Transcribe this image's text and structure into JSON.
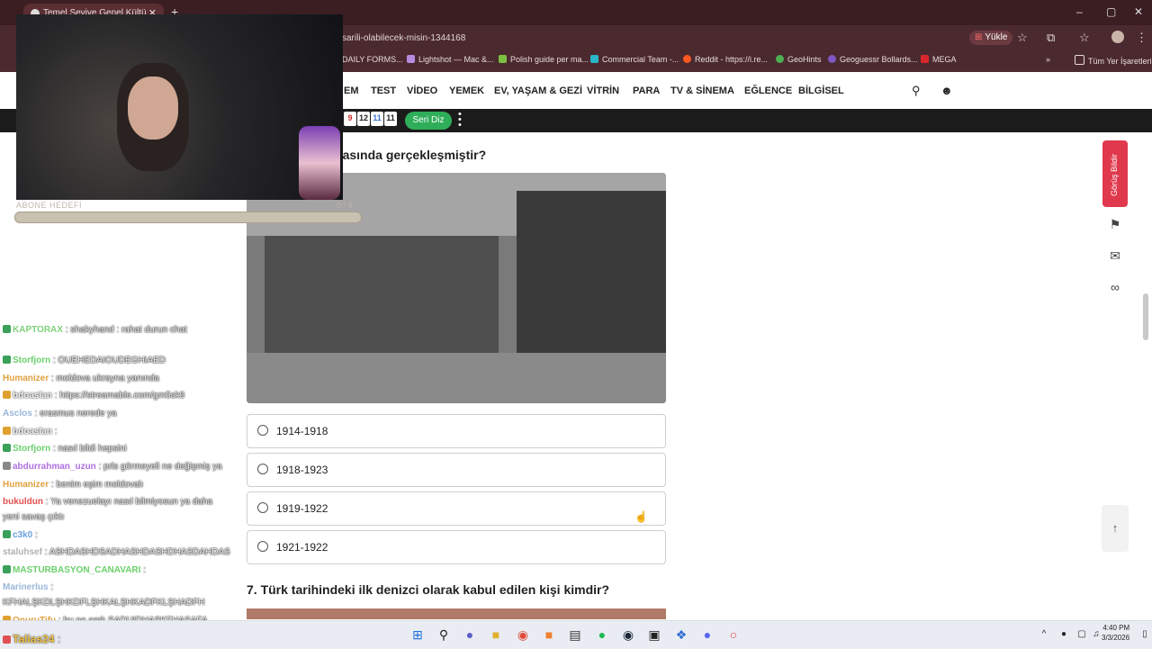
{
  "browser": {
    "tab_title": "Temel Seviye Genel Kültür Testi",
    "url_visible": "sarili-olabilecek-misin-1344168",
    "install_label": "Yükle",
    "bookmarks": [
      "DAILY FORMS...",
      "Lightshot — Mac &...",
      "Polish guide per ma...",
      "Commercial Team -...",
      "Reddit - https://i.re...",
      "GeoHints",
      "Geoguessr Bollards...",
      "MEGA"
    ],
    "all_bookmarks": "Tüm Yer İşaretleri"
  },
  "nav": {
    "items": [
      "EM",
      "TEST",
      "VİDEO",
      "YEMEK",
      "EV, YAŞAM & GEZİ",
      "VİTRİN",
      "PARA",
      "TV & SİNEMA",
      "EĞLENCE",
      "BİLGİSEL"
    ]
  },
  "subbar": {
    "scores": [
      "9",
      "12",
      "11",
      "11"
    ],
    "seri_diz": "Seri Diz"
  },
  "quiz": {
    "question_partial": "şı hangi yıllar arasında gerçekleşmiştir?",
    "options": [
      "1914-1918",
      "1918-1923",
      "1919-1922",
      "1921-1922"
    ],
    "next_question": "7. Türk tarihindeki ilk denizci olarak kabul edilen kişi kimdir?"
  },
  "right_panel": {
    "feedback_label": "Görüş Bildir"
  },
  "overlay": {
    "subgoal_label": "ABONE HEDEFİ",
    "subgoal_count": "0 / 4"
  },
  "chat": [
    {
      "user": "KAPTORAX",
      "msg": ": shakyhand : rahat durun chat",
      "color": "#7fd07a"
    },
    {
      "user": "Storfjorn",
      "msg": ": OUEHEDAIOUDEGHIAED",
      "color": "#6ad06a"
    },
    {
      "user": "Humanizer",
      "msg": ": moldova ukrayna yanında",
      "color": "#e0a040"
    },
    {
      "user": "bdoaslan",
      "msg": ": https://streamable.com/gm5sk9",
      "color": "#f0f0f0"
    },
    {
      "user": "Asclos",
      "msg": ": erasmus nerede ya",
      "color": "#9ab6d8"
    },
    {
      "user": "bdoaslan",
      "msg": ":",
      "color": "#f0f0f0"
    },
    {
      "user": "Storfjorn",
      "msg": ": nasıl bildi hepsini",
      "color": "#6ad06a"
    },
    {
      "user": "abdurrahman_uzun",
      "msg": ": prls görmeyeli ne değişmiş ya",
      "color": "#b070e0"
    },
    {
      "user": "Humanizer",
      "msg": ": benim eşim moldovalı",
      "color": "#e0a040"
    },
    {
      "user": "bukuldun",
      "msg": ": Ya venezuelayı nasıl bilmiyosun ya daha",
      "color": "#e05050"
    },
    {
      "user": "",
      "msg": "yeni savaş çıktı",
      "color": "#ffffff"
    },
    {
      "user": "c3k0",
      "msg": ":",
      "color": "#6aa0e0"
    },
    {
      "user": "staluhsef",
      "msg": ": ASHDASHDSADHASHDASHDHASDAHDAS",
      "color": "#b0b0b0"
    },
    {
      "user": "MASTURBASYON_CANAVARI",
      "msg": ":",
      "color": "#6ad06a"
    },
    {
      "user": "Marinerlus",
      "msg": ":",
      "color": "#9ab6d8"
    },
    {
      "user": "",
      "msg": "KFHALŞKDLŞHKDFLŞHKALŞHKADFKLŞHADFH",
      "color": "#ffffff"
    },
    {
      "user": "OnuruTifu",
      "msg": ": bu ne amk SADUIDHASKFHASAFA",
      "color": "#e0a040"
    },
    {
      "user": "Talias24",
      "msg": ":",
      "color": "#f0c040"
    }
  ],
  "taskbar": {
    "time": "4:40 PM",
    "date": "3/3/2026"
  }
}
